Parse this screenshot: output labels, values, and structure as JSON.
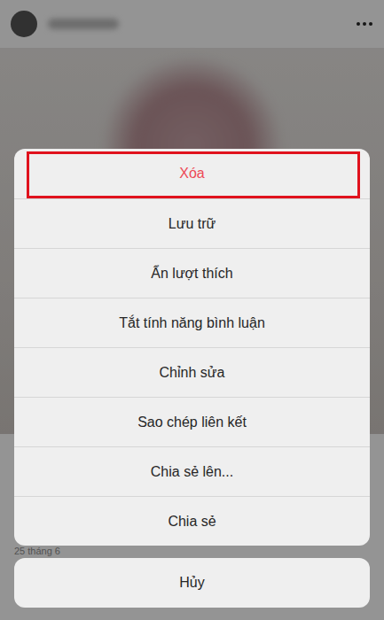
{
  "post": {
    "date": "25 tháng 6"
  },
  "action_sheet": {
    "items": [
      {
        "label": "Xóa",
        "kind": "destructive",
        "highlighted": true
      },
      {
        "label": "Lưu trữ",
        "kind": "normal",
        "highlighted": false
      },
      {
        "label": "Ẩn lượt thích",
        "kind": "normal",
        "highlighted": false
      },
      {
        "label": "Tắt tính năng bình luận",
        "kind": "normal",
        "highlighted": false
      },
      {
        "label": "Chỉnh sửa",
        "kind": "normal",
        "highlighted": false
      },
      {
        "label": "Sao chép liên kết",
        "kind": "normal",
        "highlighted": false
      },
      {
        "label": "Chia sẻ lên...",
        "kind": "normal",
        "highlighted": false
      },
      {
        "label": "Chia sẻ",
        "kind": "normal",
        "highlighted": false
      }
    ]
  },
  "cancel": {
    "label": "Hủy"
  }
}
